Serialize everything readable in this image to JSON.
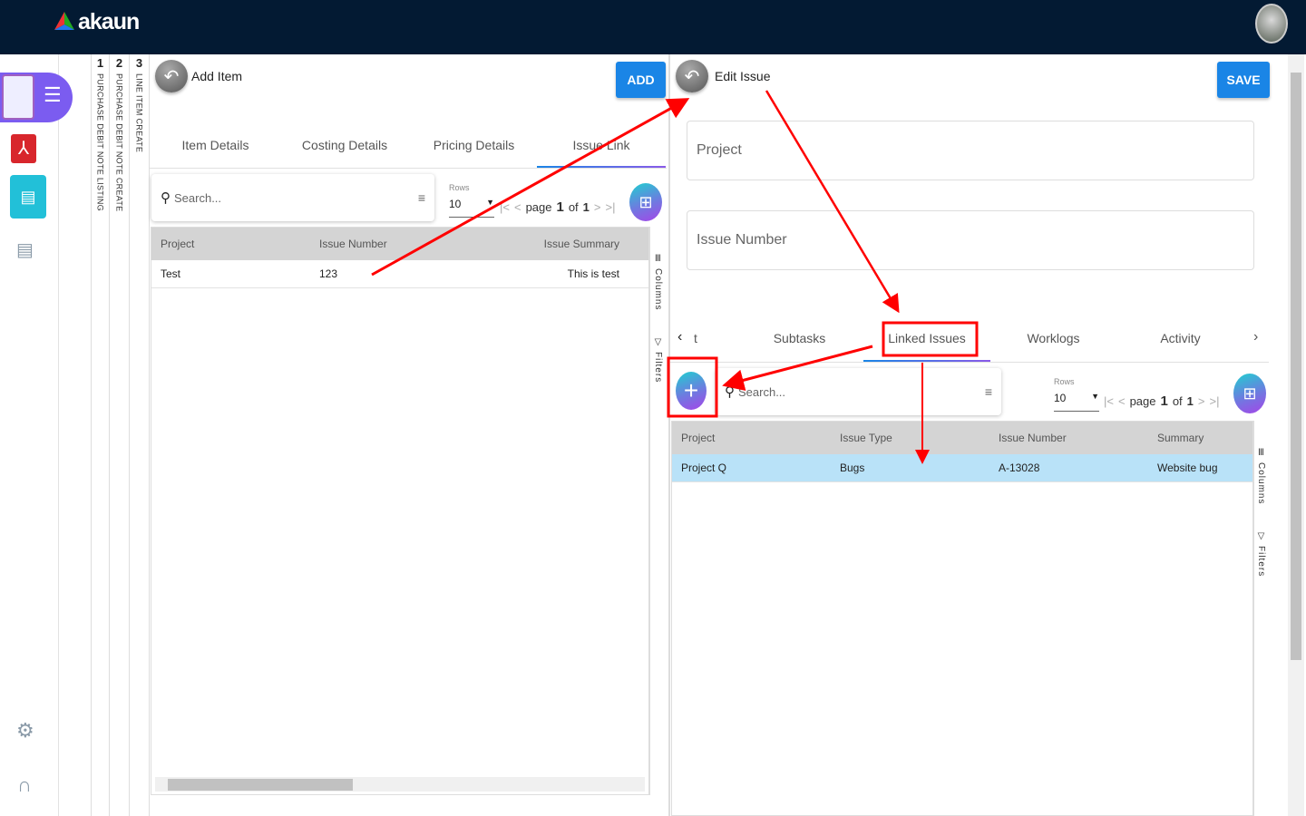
{
  "app": {
    "brand": "akaun"
  },
  "breadcrumb_tabs": [
    {
      "num": "1",
      "label": "PURCHASE DEBIT NOTE LISTING"
    },
    {
      "num": "2",
      "label": "PURCHASE DEBIT NOTE CREATE"
    },
    {
      "num": "3",
      "label": "LINE ITEM CREATE"
    }
  ],
  "left_panel": {
    "title": "Add Item",
    "action": "ADD",
    "tabs": [
      "Item Details",
      "Costing Details",
      "Pricing Details",
      "Issue Link"
    ],
    "active_tab": "Issue Link",
    "search_placeholder": "Search...",
    "rows_label": "Rows",
    "rows_value": "10",
    "page_label": "page",
    "page": "1",
    "of_label": "of",
    "pages": "1",
    "columns": [
      "Project",
      "Issue Number",
      "Issue Summary"
    ],
    "rows": [
      [
        "Test",
        "123",
        "This is test"
      ]
    ],
    "columns_tool": "Columns",
    "filters_tool": "Filters"
  },
  "right_panel": {
    "title": "Edit Issue",
    "action": "SAVE",
    "fields": [
      "Project",
      "Issue Number"
    ],
    "tabs": [
      "t",
      "Subtasks",
      "Linked Issues",
      "Worklogs",
      "Activity"
    ],
    "active_tab": "Linked Issues",
    "search_placeholder": "Search...",
    "rows_label": "Rows",
    "rows_value": "10",
    "page_label": "page",
    "page": "1",
    "of_label": "of",
    "pages": "1",
    "columns": [
      "Project",
      "Issue Type",
      "Issue Number",
      "Summary"
    ],
    "rows": [
      [
        "Project Q",
        "Bugs",
        "A-13028",
        "Website bug"
      ]
    ],
    "columns_tool": "Columns",
    "filters_tool": "Filters"
  },
  "colors": {
    "header": "#031a33",
    "accent": "#1a85e6",
    "annotation": "#ff0000",
    "selected_row": "#b9e2f8"
  }
}
